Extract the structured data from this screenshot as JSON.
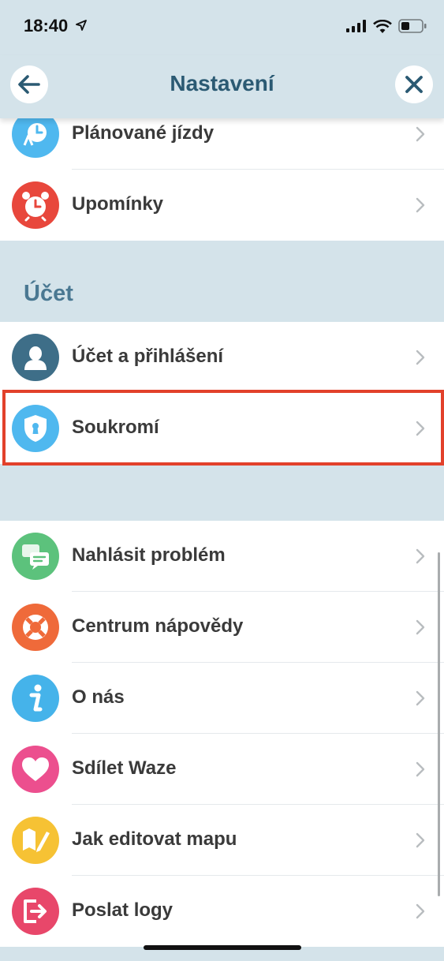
{
  "status": {
    "time": "18:40"
  },
  "header": {
    "title": "Nastavení"
  },
  "top_items": [
    {
      "label": "Plánované jízdy",
      "icon": "scheduled-drives-icon",
      "color": "#4fb8ef"
    },
    {
      "label": "Upomínky",
      "icon": "alarm-clock-icon",
      "color": "#e8473c"
    }
  ],
  "account_section": {
    "title": "Účet",
    "items": [
      {
        "label": "Účet a přihlášení",
        "icon": "user-account-icon",
        "color": "#3e6e88"
      },
      {
        "label": "Soukromí",
        "icon": "privacy-shield-icon",
        "color": "#4fb8ef"
      }
    ]
  },
  "bottom_items": [
    {
      "label": "Nahlásit problém",
      "icon": "report-problem-icon",
      "color": "#5cc27c"
    },
    {
      "label": "Centrum nápovědy",
      "icon": "help-center-icon",
      "color": "#ef6a3a"
    },
    {
      "label": "O nás",
      "icon": "info-icon",
      "color": "#45b3ea"
    },
    {
      "label": "Sdílet Waze",
      "icon": "heart-icon",
      "color": "#ec4f8e"
    },
    {
      "label": "Jak editovat mapu",
      "icon": "map-edit-icon",
      "color": "#f6c234"
    },
    {
      "label": "Poslat logy",
      "icon": "send-logs-icon",
      "color": "#e8476a"
    }
  ]
}
